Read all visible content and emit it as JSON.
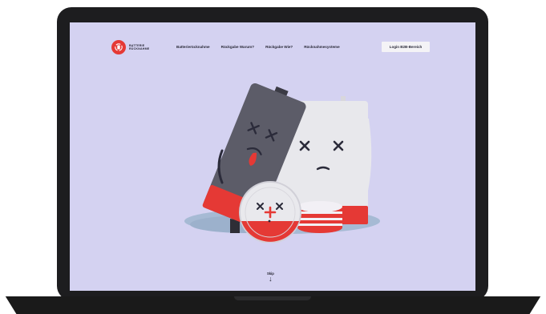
{
  "logo": {
    "line1": "BATTERIE",
    "line2": "RÜCKNAHME"
  },
  "nav": {
    "links": [
      "Batterierücknahme",
      "Rückgabe Warum?",
      "Rückgabe Wie?",
      "Rücknahmesysteme"
    ],
    "login_label": "Login B2B-Bereich"
  },
  "coin_text": "",
  "skip": {
    "label": "Skip",
    "arrow": "↓"
  },
  "colors": {
    "screen_bg": "#d4d2f1",
    "accent_red": "#e53935",
    "battery_dark": "#5c5c68",
    "battery_light": "#e8e8ec",
    "bezel": "#1d1d1f"
  },
  "icons": [
    "recycle-battery-logo-icon",
    "arrow-down-icon"
  ]
}
